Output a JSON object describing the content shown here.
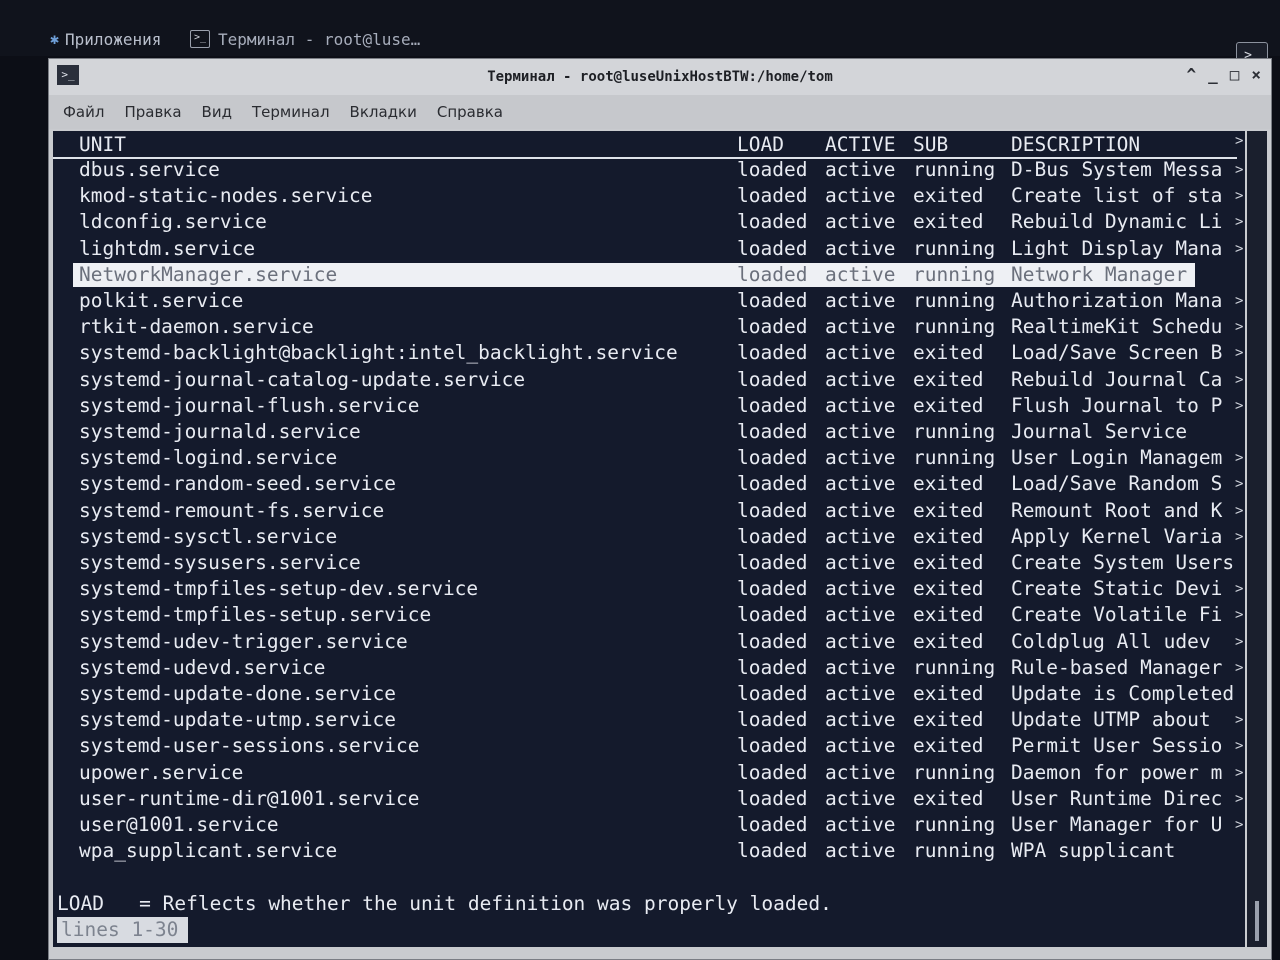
{
  "panel": {
    "apps_label": "Приложения",
    "task_label": "Терминал - root@luse…",
    "apps_icon": "apps-icon",
    "task_icon": "terminal-icon"
  },
  "window": {
    "title": "Терминал - root@luseUnixHostBTW:/home/tom",
    "controls": [
      "^",
      "_",
      "□",
      "×"
    ]
  },
  "menu": [
    "Файл",
    "Правка",
    "Вид",
    "Терминал",
    "Вкладки",
    "Справка"
  ],
  "table": {
    "headers": {
      "unit": "UNIT",
      "load": "LOAD",
      "active": "ACTIVE",
      "sub": "SUB",
      "description": "DESCRIPTION"
    },
    "selected_index": 4,
    "rows": [
      {
        "unit": "dbus.service",
        "load": "loaded",
        "active": "active",
        "sub": "running",
        "desc": "D-Bus System Messa",
        "more": true
      },
      {
        "unit": "kmod-static-nodes.service",
        "load": "loaded",
        "active": "active",
        "sub": "exited",
        "desc": "Create list of sta",
        "more": true
      },
      {
        "unit": "ldconfig.service",
        "load": "loaded",
        "active": "active",
        "sub": "exited",
        "desc": "Rebuild Dynamic Li",
        "more": true
      },
      {
        "unit": "lightdm.service",
        "load": "loaded",
        "active": "active",
        "sub": "running",
        "desc": "Light Display Mana",
        "more": true
      },
      {
        "unit": "NetworkManager.service",
        "load": "loaded",
        "active": "active",
        "sub": "running",
        "desc": "Network Manager",
        "more": false
      },
      {
        "unit": "polkit.service",
        "load": "loaded",
        "active": "active",
        "sub": "running",
        "desc": "Authorization Mana",
        "more": true
      },
      {
        "unit": "rtkit-daemon.service",
        "load": "loaded",
        "active": "active",
        "sub": "running",
        "desc": "RealtimeKit Schedu",
        "more": true
      },
      {
        "unit": "systemd-backlight@backlight:intel_backlight.service",
        "load": "loaded",
        "active": "active",
        "sub": "exited",
        "desc": "Load/Save Screen B",
        "more": true
      },
      {
        "unit": "systemd-journal-catalog-update.service",
        "load": "loaded",
        "active": "active",
        "sub": "exited",
        "desc": "Rebuild Journal Ca",
        "more": true
      },
      {
        "unit": "systemd-journal-flush.service",
        "load": "loaded",
        "active": "active",
        "sub": "exited",
        "desc": "Flush Journal to P",
        "more": true
      },
      {
        "unit": "systemd-journald.service",
        "load": "loaded",
        "active": "active",
        "sub": "running",
        "desc": "Journal Service",
        "more": false
      },
      {
        "unit": "systemd-logind.service",
        "load": "loaded",
        "active": "active",
        "sub": "running",
        "desc": "User Login Managem",
        "more": true
      },
      {
        "unit": "systemd-random-seed.service",
        "load": "loaded",
        "active": "active",
        "sub": "exited",
        "desc": "Load/Save Random S",
        "more": true
      },
      {
        "unit": "systemd-remount-fs.service",
        "load": "loaded",
        "active": "active",
        "sub": "exited",
        "desc": "Remount Root and K",
        "more": true
      },
      {
        "unit": "systemd-sysctl.service",
        "load": "loaded",
        "active": "active",
        "sub": "exited",
        "desc": "Apply Kernel Varia",
        "more": true
      },
      {
        "unit": "systemd-sysusers.service",
        "load": "loaded",
        "active": "active",
        "sub": "exited",
        "desc": "Create System Users",
        "more": false
      },
      {
        "unit": "systemd-tmpfiles-setup-dev.service",
        "load": "loaded",
        "active": "active",
        "sub": "exited",
        "desc": "Create Static Devi",
        "more": true
      },
      {
        "unit": "systemd-tmpfiles-setup.service",
        "load": "loaded",
        "active": "active",
        "sub": "exited",
        "desc": "Create Volatile Fi",
        "more": true
      },
      {
        "unit": "systemd-udev-trigger.service",
        "load": "loaded",
        "active": "active",
        "sub": "exited",
        "desc": "Coldplug All udev",
        "more": true
      },
      {
        "unit": "systemd-udevd.service",
        "load": "loaded",
        "active": "active",
        "sub": "running",
        "desc": "Rule-based Manager",
        "more": true
      },
      {
        "unit": "systemd-update-done.service",
        "load": "loaded",
        "active": "active",
        "sub": "exited",
        "desc": "Update is Completed",
        "more": false
      },
      {
        "unit": "systemd-update-utmp.service",
        "load": "loaded",
        "active": "active",
        "sub": "exited",
        "desc": "Update UTMP about",
        "more": true
      },
      {
        "unit": "systemd-user-sessions.service",
        "load": "loaded",
        "active": "active",
        "sub": "exited",
        "desc": "Permit User Sessio",
        "more": true
      },
      {
        "unit": "upower.service",
        "load": "loaded",
        "active": "active",
        "sub": "running",
        "desc": "Daemon for power m",
        "more": true
      },
      {
        "unit": "user-runtime-dir@1001.service",
        "load": "loaded",
        "active": "active",
        "sub": "exited",
        "desc": "User Runtime Direc",
        "more": true
      },
      {
        "unit": "user@1001.service",
        "load": "loaded",
        "active": "active",
        "sub": "running",
        "desc": "User Manager for U",
        "more": true
      },
      {
        "unit": "wpa_supplicant.service",
        "load": "loaded",
        "active": "active",
        "sub": "running",
        "desc": "WPA supplicant",
        "more": false
      }
    ]
  },
  "legend": "LOAD   = Reflects whether the unit definition was properly loaded.",
  "status": "lines 1-30",
  "more_glyph": ">",
  "colors": {
    "terminal_bg": "#141a2c",
    "terminal_fg": "#e8ebf2",
    "selection_bg": "#eef0f4"
  }
}
